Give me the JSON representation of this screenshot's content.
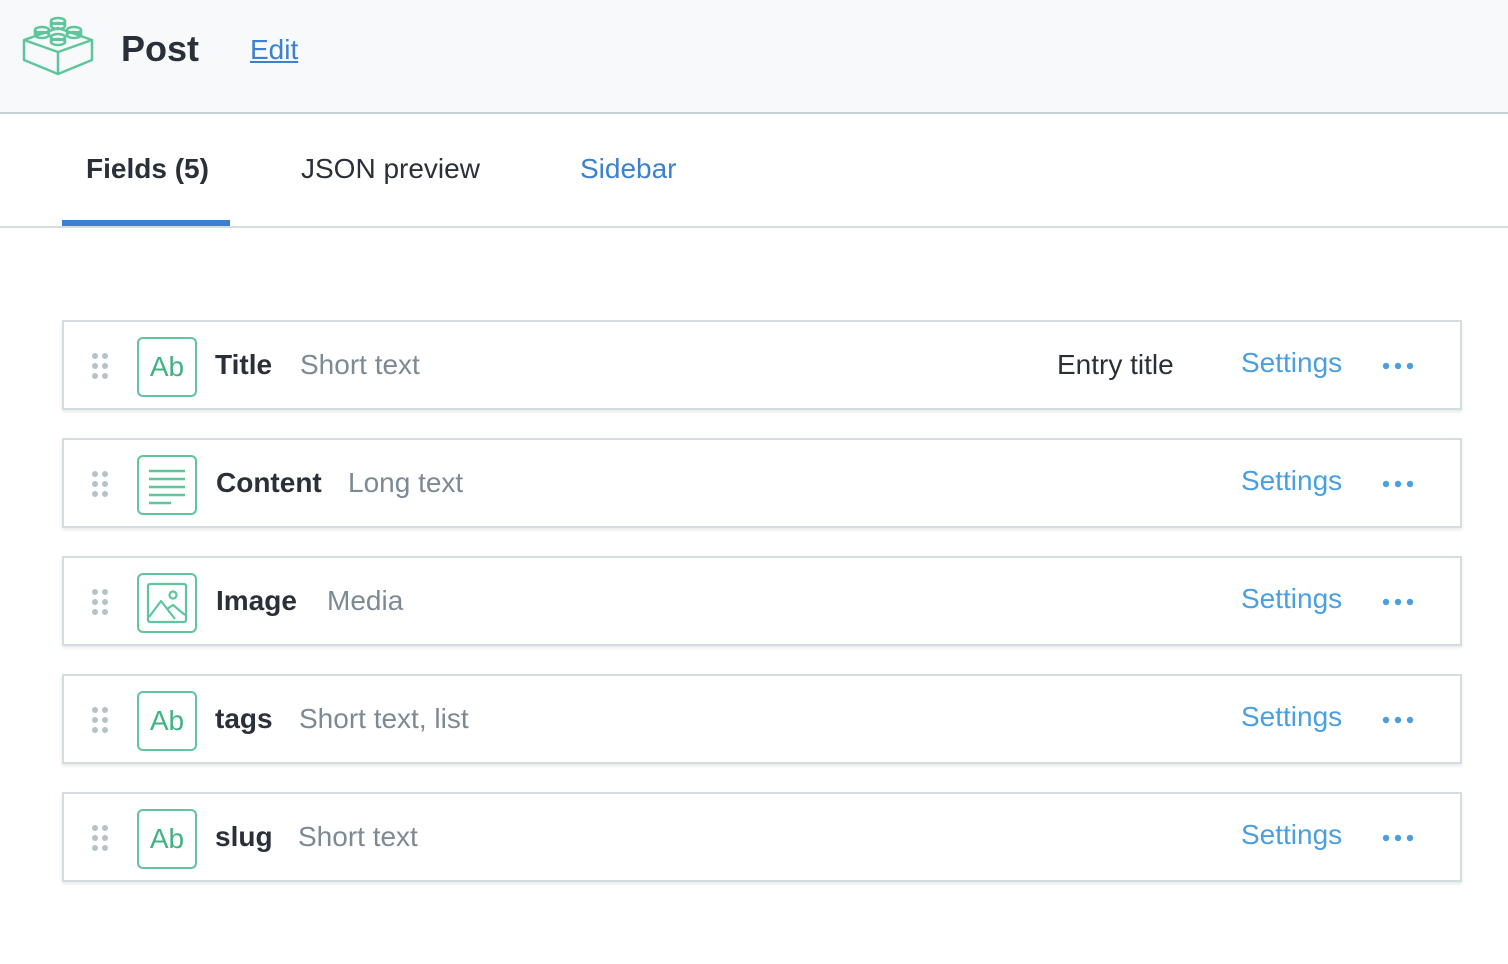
{
  "header": {
    "title": "Post",
    "edit_label": "Edit",
    "logo_icon": "content-type-block-icon"
  },
  "tabs": [
    {
      "label": "Fields (5)",
      "active": true
    },
    {
      "label": "JSON preview",
      "active": false
    },
    {
      "label": "Sidebar",
      "active": false
    }
  ],
  "fields": [
    {
      "name": "Title",
      "type": "Short text",
      "icon": "ab-icon",
      "entry_title_label": "Entry title",
      "settings_label": "Settings",
      "more_icon": "more-dots-icon"
    },
    {
      "name": "Content",
      "type": "Long text",
      "icon": "long-text-icon",
      "settings_label": "Settings",
      "more_icon": "more-dots-icon"
    },
    {
      "name": "Image",
      "type": "Media",
      "icon": "image-icon",
      "settings_label": "Settings",
      "more_icon": "more-dots-icon"
    },
    {
      "name": "tags",
      "type": "Short text, list",
      "icon": "ab-icon",
      "settings_label": "Settings",
      "more_icon": "more-dots-icon"
    },
    {
      "name": "slug",
      "type": "Short text",
      "icon": "ab-icon",
      "settings_label": "Settings",
      "more_icon": "more-dots-icon"
    }
  ],
  "icons": {
    "ab_text": "Ab"
  },
  "colors": {
    "accent": "#3c80cf",
    "link": "#4a9fe0",
    "field_icon": "#5fc59a",
    "text_dark": "#2a3039",
    "text_muted": "#7c8a96",
    "header_bg": "#f7f9fa"
  }
}
